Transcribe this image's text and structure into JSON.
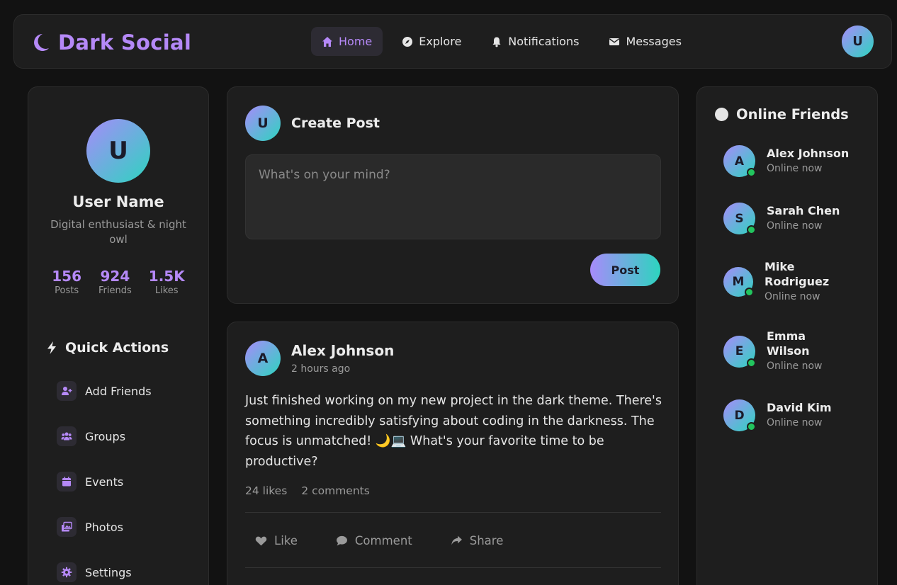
{
  "header": {
    "brand": "Dark Social",
    "nav": [
      {
        "label": "Home",
        "icon": "home-icon"
      },
      {
        "label": "Explore",
        "icon": "compass-icon"
      },
      {
        "label": "Notifications",
        "icon": "bell-icon"
      },
      {
        "label": "Messages",
        "icon": "envelope-icon"
      }
    ],
    "avatar_initial": "U"
  },
  "profile": {
    "initial": "U",
    "name": "User Name",
    "bio": "Digital enthusiast & night owl",
    "stats": [
      {
        "value": "156",
        "label": "Posts"
      },
      {
        "value": "924",
        "label": "Friends"
      },
      {
        "value": "1.5K",
        "label": "Likes"
      }
    ]
  },
  "quick_actions": {
    "title": "Quick Actions",
    "items": [
      {
        "label": "Add Friends",
        "icon": "user-plus-icon"
      },
      {
        "label": "Groups",
        "icon": "users-icon"
      },
      {
        "label": "Events",
        "icon": "calendar-icon"
      },
      {
        "label": "Photos",
        "icon": "images-icon"
      },
      {
        "label": "Settings",
        "icon": "gear-icon"
      }
    ]
  },
  "create_post": {
    "initial": "U",
    "title": "Create Post",
    "placeholder": "What's on your mind?",
    "button": "Post"
  },
  "post": {
    "initial": "A",
    "author": "Alex Johnson",
    "time": "2 hours ago",
    "text": "Just finished working on my new project in the dark theme. There's something incredibly satisfying about coding in the darkness. The focus is unmatched! 🌙💻 What's your favorite time to be productive?",
    "likes": "24 likes",
    "comments": "2 comments",
    "actions": {
      "like": "Like",
      "comment": "Comment",
      "share": "Share"
    }
  },
  "online_friends": {
    "title": "Online Friends",
    "friends": [
      {
        "initial": "A",
        "name": "Alex Johnson",
        "status": "Online now"
      },
      {
        "initial": "S",
        "name": "Sarah Chen",
        "status": "Online now"
      },
      {
        "initial": "M",
        "name": "Mike Rodriguez",
        "status": "Online now"
      },
      {
        "initial": "E",
        "name": "Emma Wilson",
        "status": "Online now"
      },
      {
        "initial": "D",
        "name": "David Kim",
        "status": "Online now"
      }
    ]
  },
  "colors": {
    "accent": "#b589f7",
    "gradient_start": "#a78bfa",
    "gradient_end": "#2dd4bf",
    "online": "#22c55e",
    "background": "#121212",
    "panel": "#1e1e1e"
  }
}
